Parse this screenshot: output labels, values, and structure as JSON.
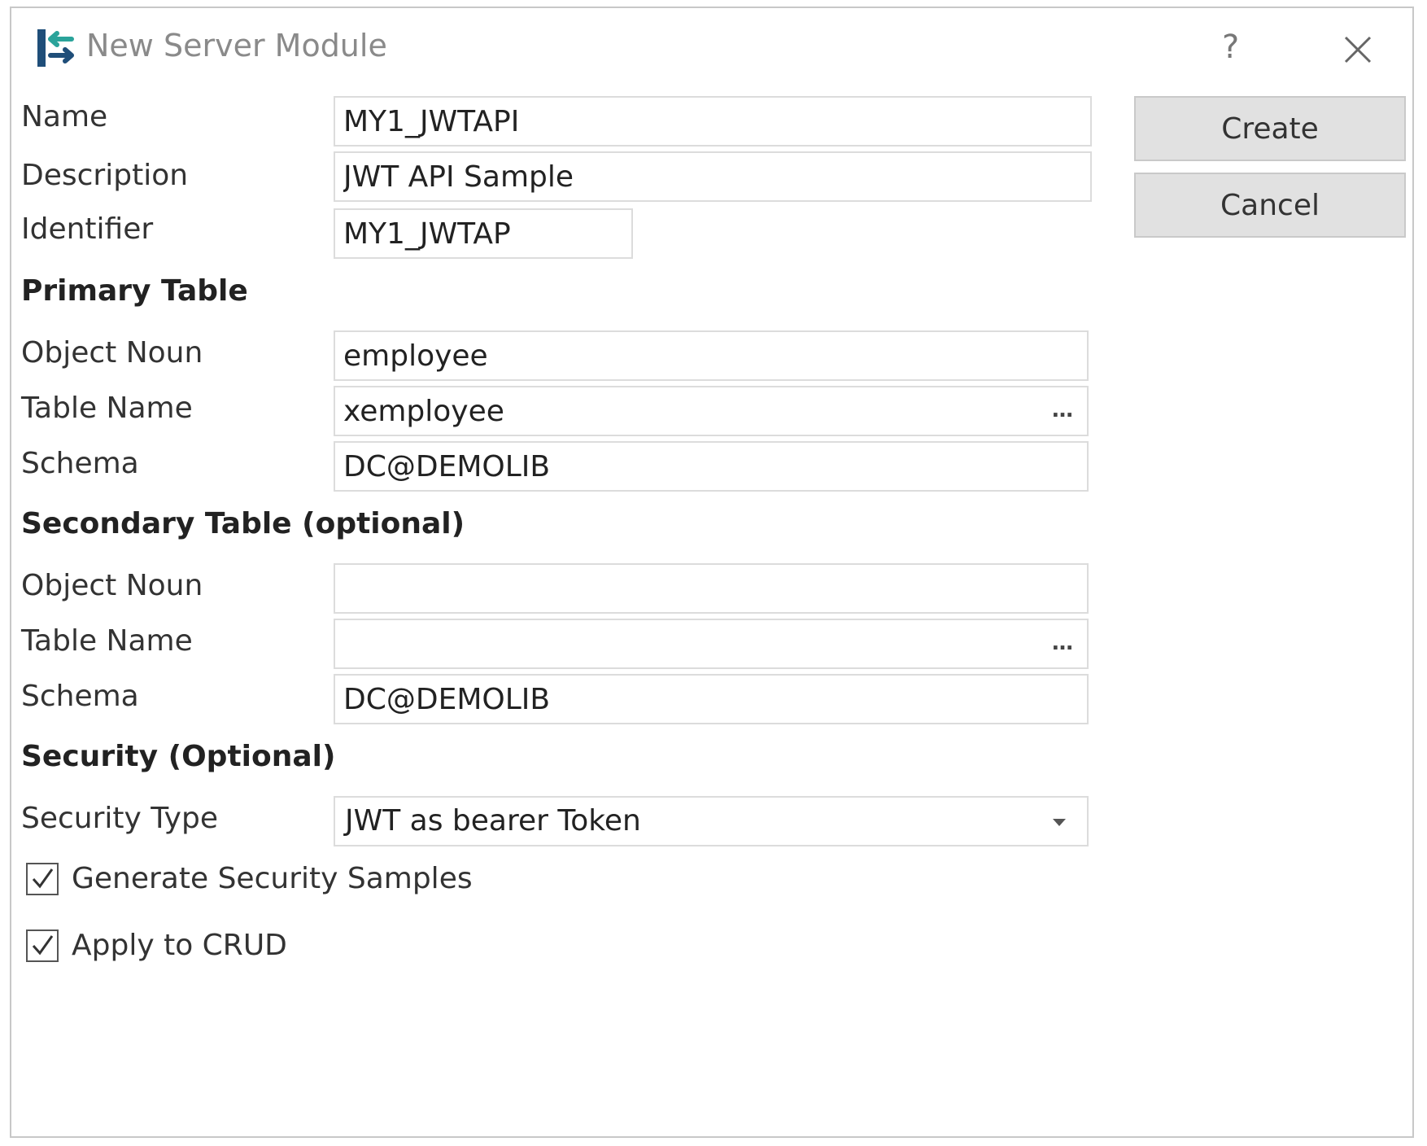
{
  "window": {
    "title": "New Server Module",
    "help_label": "?"
  },
  "buttons": {
    "create_label": "Create",
    "cancel_label": "Cancel"
  },
  "general": {
    "name_label": "Name",
    "name_value": "MY1_JWTAPI",
    "description_label": "Description",
    "description_value": "JWT API Sample",
    "identifier_label": "Identifier",
    "identifier_value": "MY1_JWTAP"
  },
  "primary_table": {
    "heading": "Primary Table",
    "object_noun_label": "Object Noun",
    "object_noun_value": "employee",
    "table_name_label": "Table Name",
    "table_name_value": "xemployee",
    "browse_label": "…",
    "schema_label": "Schema",
    "schema_value": "DC@DEMOLIB"
  },
  "secondary_table": {
    "heading": "Secondary Table (optional)",
    "object_noun_label": "Object Noun",
    "object_noun_value": "",
    "table_name_label": "Table Name",
    "table_name_value": "",
    "browse_label": "…",
    "schema_label": "Schema",
    "schema_value": "DC@DEMOLIB"
  },
  "security": {
    "heading": "Security (Optional)",
    "type_label": "Security Type",
    "type_value": "JWT as bearer Token",
    "generate_samples_label": "Generate Security Samples",
    "generate_samples_checked": true,
    "apply_crud_label": "Apply to CRUD",
    "apply_crud_checked": true
  },
  "icons": {
    "app": "server-module-icon",
    "help": "help-icon",
    "close": "close-icon",
    "dropdown": "chevron-down-icon",
    "check": "checkmark-icon"
  },
  "colors": {
    "icon_dark": "#1f4e79",
    "icon_teal": "#2aa39a",
    "button_bg": "#e1e1e1",
    "field_border": "#dcdcdc"
  }
}
